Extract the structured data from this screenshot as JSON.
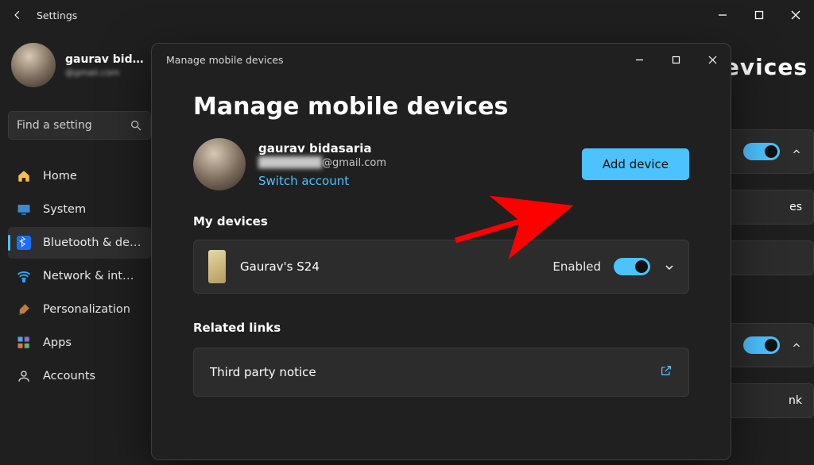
{
  "colors": {
    "accent": "#4cc2ff"
  },
  "bg_window": {
    "title": "Settings",
    "profile": {
      "name": "gaurav bid…",
      "sub": "@gmail.com"
    },
    "search_placeholder": "Find a setting",
    "nav": {
      "home": "Home",
      "system": "System",
      "bluetooth": "Bluetooth & de…",
      "network": "Network & int…",
      "personalization": "Personalization",
      "apps": "Apps",
      "accounts": "Accounts"
    },
    "right_panel": {
      "title_fragment": "evices",
      "card2_label": "es",
      "card4_label": "nk"
    }
  },
  "modal": {
    "titlebar": "Manage mobile devices",
    "heading": "Manage mobile devices",
    "account": {
      "name": "gaurav bidasaria",
      "email_hidden": "████████",
      "email_domain": "@gmail.com",
      "switch": "Switch account"
    },
    "add_device": "Add device",
    "my_devices": "My devices",
    "device": {
      "name": "Gaurav's S24",
      "status": "Enabled"
    },
    "related_links": "Related links",
    "link1": "Third party notice"
  }
}
